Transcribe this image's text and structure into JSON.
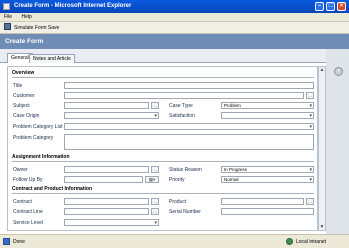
{
  "window": {
    "title": "Create Form - Microsoft Internet Explorer"
  },
  "menu": {
    "items": [
      "File",
      "Help"
    ]
  },
  "toolbar": {
    "simulate_label": "Simulate Form Save"
  },
  "form": {
    "title": "Create Form"
  },
  "tabs": [
    {
      "label": "General"
    },
    {
      "label": "Notes and Article"
    }
  ],
  "sections": {
    "overview": "Overview",
    "assignment": "Assignment Information",
    "contract": "Contract and Product Information"
  },
  "fields": {
    "title": {
      "label": "Title",
      "value": ""
    },
    "customer": {
      "label": "Customer",
      "value": ""
    },
    "subject": {
      "label": "Subject",
      "value": ""
    },
    "case_type": {
      "label": "Case Type",
      "value": "Problem"
    },
    "case_origin": {
      "label": "Case Origin",
      "value": ""
    },
    "satisfaction": {
      "label": "Satisfaction",
      "value": ""
    },
    "problem_category_list": {
      "label": "Problem Category List",
      "value": ""
    },
    "problem_category": {
      "label": "Problem Category",
      "value": ""
    },
    "owner": {
      "label": "Owner",
      "value": ""
    },
    "status_reason": {
      "label": "Status Reason",
      "value": "In Progress"
    },
    "follow_up_by": {
      "label": "Follow Up By",
      "value": ""
    },
    "priority": {
      "label": "Priority",
      "value": "Normal"
    },
    "contract": {
      "label": "Contract",
      "value": ""
    },
    "product": {
      "label": "Product",
      "value": ""
    },
    "contract_line": {
      "label": "Contract Line",
      "value": ""
    },
    "serial_number": {
      "label": "Serial Number",
      "value": ""
    },
    "service_level": {
      "label": "Service Level",
      "value": ""
    }
  },
  "status": {
    "text": "Done",
    "zone": "Local intranet"
  }
}
